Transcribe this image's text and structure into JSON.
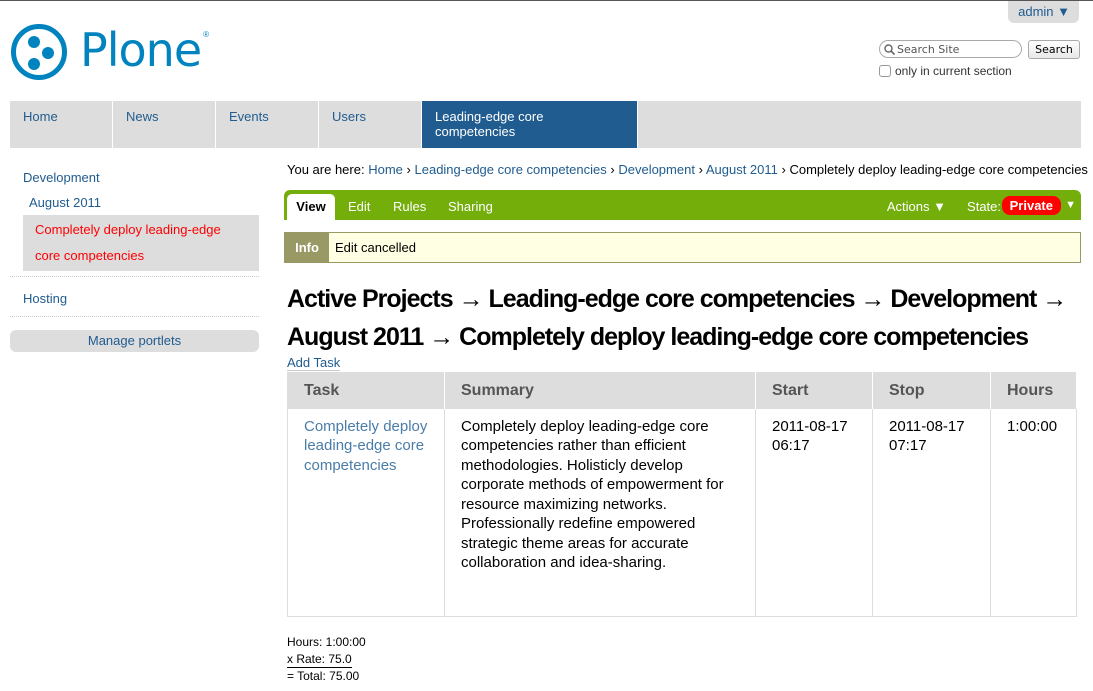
{
  "site": {
    "logo_text": "Plone",
    "logo_reg": "®"
  },
  "user_menu": {
    "label": "admin ▼"
  },
  "search": {
    "placeholder": "Search Site",
    "value": "",
    "button_label": "Search",
    "section_only_label": "only in current section",
    "section_only_checked": false
  },
  "nav": {
    "items": [
      {
        "label": "Home",
        "active": false
      },
      {
        "label": "News",
        "active": false
      },
      {
        "label": "Events",
        "active": false
      },
      {
        "label": "Users",
        "active": false
      },
      {
        "label": "Leading-edge core competencies",
        "active": true
      }
    ]
  },
  "portlet": {
    "items": [
      {
        "label": "Development"
      },
      {
        "label": "August 2011"
      },
      {
        "label": "Completely deploy leading-edge core competencies",
        "current": true
      },
      {
        "label": "Hosting"
      }
    ],
    "manage_label": "Manage portlets"
  },
  "breadcrumbs": {
    "prefix": "You are here:",
    "items": [
      {
        "label": "Home"
      },
      {
        "label": "Leading-edge core competencies"
      },
      {
        "label": "Development"
      },
      {
        "label": "August 2011"
      },
      {
        "label": "Completely deploy leading-edge core competencies"
      }
    ],
    "separator": "›"
  },
  "edit_bar": {
    "tabs": [
      "View",
      "Edit",
      "Rules",
      "Sharing"
    ],
    "actions_label": "Actions ▼",
    "state_label": "State:",
    "state_value": "Private",
    "state_arrow": "▼",
    "colors": {
      "bar": "#74ae0b",
      "state": "#ff0000"
    }
  },
  "message": {
    "type": "Info",
    "text": "Edit cancelled"
  },
  "page": {
    "title": "Active Projects → Leading-edge core competencies → Development → August 2011 → Completely deploy leading-edge core competencies",
    "add_task_label": "Add Task"
  },
  "table": {
    "headers": [
      "Task",
      "Summary",
      "Start",
      "Stop",
      "Hours"
    ],
    "rows": [
      {
        "task": "Completely deploy leading-edge core competencies",
        "summary": "Completely deploy leading-edge core competencies rather than efficient methodologies. Holisticly develop corporate methods of empowerment for resource maximizing networks. Professionally redefine empowered strategic theme areas for accurate collaboration and idea-sharing.",
        "start_date": "2011-08-17",
        "start_time": "06:17",
        "stop_date": "2011-08-17",
        "stop_time": "07:17",
        "hours": "1:00:00"
      }
    ]
  },
  "totals": {
    "hours": "Hours: 1:00:00",
    "rate": "x Rate: 75.0",
    "total": "= Total: 75.00"
  }
}
